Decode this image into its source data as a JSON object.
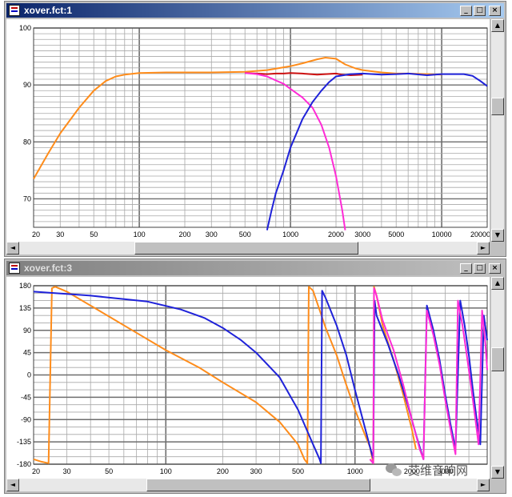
{
  "windows": [
    {
      "id": "top",
      "title": "xover.fct:1",
      "active": true,
      "buttons": {
        "minimize": "_",
        "maximize": "□",
        "close": "×"
      },
      "chart_data": {
        "type": "line",
        "x_scale": "log",
        "xlim": [
          20,
          20000
        ],
        "ylim": [
          65,
          100
        ],
        "x_ticks": [
          20,
          30,
          50,
          100,
          200,
          300,
          500,
          1000,
          2000,
          3000,
          5000,
          10000,
          20000
        ],
        "x_tick_labels": [
          "20",
          "30",
          "50",
          "100",
          "200",
          "300",
          "500",
          "1000",
          "2000",
          "3000",
          "5000",
          "10000",
          "20000"
        ],
        "y_ticks": [
          100,
          90,
          80,
          70
        ],
        "y_tick_labels": [
          "100",
          "90",
          "80",
          "70"
        ],
        "grid": true,
        "series": [
          {
            "color": "#ff8c1a",
            "points": [
              [
                20,
                73.5
              ],
              [
                25,
                78
              ],
              [
                30,
                81.5
              ],
              [
                40,
                86
              ],
              [
                50,
                89
              ],
              [
                60,
                90.7
              ],
              [
                70,
                91.5
              ],
              [
                80,
                91.8
              ],
              [
                100,
                92.1
              ],
              [
                150,
                92.2
              ],
              [
                200,
                92.2
              ],
              [
                300,
                92.2
              ],
              [
                500,
                92.3
              ],
              [
                700,
                92.6
              ],
              [
                900,
                93.1
              ],
              [
                1000,
                93.3
              ],
              [
                1200,
                93.8
              ],
              [
                1500,
                94.5
              ],
              [
                1700,
                94.8
              ],
              [
                2000,
                94.6
              ],
              [
                2300,
                93.6
              ],
              [
                2700,
                92.9
              ],
              [
                3000,
                92.6
              ],
              [
                4000,
                92.2
              ],
              [
                5000,
                92.0
              ],
              [
                6000,
                92.0
              ],
              [
                8000,
                91.9
              ],
              [
                10000,
                91.8
              ]
            ]
          },
          {
            "color": "#cc1010",
            "points": [
              [
                500,
                92.1
              ],
              [
                600,
                92.0
              ],
              [
                700,
                91.9
              ],
              [
                800,
                92.0
              ],
              [
                900,
                92.0
              ],
              [
                1000,
                92.1
              ],
              [
                1200,
                92.0
              ],
              [
                1500,
                91.8
              ],
              [
                1700,
                91.9
              ],
              [
                2000,
                92.0
              ],
              [
                2200,
                91.8
              ],
              [
                2500,
                91.7
              ],
              [
                3000,
                91.8
              ]
            ]
          },
          {
            "color": "#ff2bd6",
            "points": [
              [
                500,
                92.1
              ],
              [
                600,
                91.9
              ],
              [
                700,
                91.5
              ],
              [
                800,
                90.8
              ],
              [
                900,
                90.2
              ],
              [
                1000,
                89.3
              ],
              [
                1200,
                87.8
              ],
              [
                1400,
                86.0
              ],
              [
                1600,
                83.0
              ],
              [
                1800,
                79.0
              ],
              [
                2000,
                74.0
              ],
              [
                2200,
                68.0
              ],
              [
                2300,
                64.5
              ]
            ]
          },
          {
            "color": "#1f22d9",
            "points": [
              [
                700,
                64.5
              ],
              [
                750,
                68.0
              ],
              [
                800,
                71.0
              ],
              [
                900,
                75.0
              ],
              [
                1000,
                79.0
              ],
              [
                1200,
                84.0
              ],
              [
                1400,
                87.0
              ],
              [
                1600,
                89.0
              ],
              [
                1800,
                90.5
              ],
              [
                2000,
                91.5
              ],
              [
                2500,
                91.9
              ],
              [
                3000,
                92.0
              ],
              [
                4000,
                91.8
              ],
              [
                5000,
                91.9
              ],
              [
                6000,
                92.0
              ],
              [
                8000,
                91.7
              ],
              [
                10000,
                91.9
              ],
              [
                14000,
                91.9
              ],
              [
                16000,
                91.6
              ],
              [
                18000,
                90.7
              ],
              [
                20000,
                89.8
              ]
            ]
          }
        ]
      }
    },
    {
      "id": "bottom",
      "title": "xover.fct:3",
      "active": false,
      "buttons": {
        "minimize": "_",
        "maximize": "□",
        "close": "×"
      },
      "chart_data": {
        "type": "line",
        "x_scale": "log",
        "xlim": [
          20,
          5000
        ],
        "ylim": [
          -180,
          180
        ],
        "x_ticks": [
          20,
          30,
          50,
          100,
          200,
          300,
          500,
          1000,
          2000,
          3000
        ],
        "x_tick_labels": [
          "20",
          "30",
          "50",
          "100",
          "200",
          "300",
          "500",
          "1000",
          "2000",
          "3000"
        ],
        "y_ticks": [
          180,
          135,
          90,
          45,
          0,
          -45,
          -90,
          -135,
          -180
        ],
        "y_tick_labels": [
          "180",
          "135",
          "90",
          "45",
          "0",
          "-45",
          "-90",
          "-135",
          "-180"
        ],
        "grid": true,
        "series": [
          {
            "color": "#ff8c1a",
            "points": [
              [
                20,
                -170
              ],
              [
                22,
                -175
              ],
              [
                24,
                -178
              ],
              [
                25,
                175
              ],
              [
                26,
                178
              ],
              [
                30,
                168
              ],
              [
                40,
                140
              ],
              [
                50,
                118
              ],
              [
                70,
                85
              ],
              [
                100,
                50
              ],
              [
                150,
                15
              ],
              [
                200,
                -15
              ],
              [
                300,
                -55
              ],
              [
                400,
                -95
              ],
              [
                500,
                -140
              ],
              [
                540,
                -170
              ],
              [
                560,
                -178
              ],
              [
                570,
                178
              ],
              [
                600,
                170
              ],
              [
                700,
                95
              ],
              [
                800,
                40
              ],
              [
                900,
                -20
              ],
              [
                1000,
                -70
              ],
              [
                1100,
                -110
              ],
              [
                1200,
                -145
              ],
              [
                1250,
                -178
              ],
              [
                1260,
                178
              ],
              [
                1300,
                160
              ],
              [
                1400,
                100
              ],
              [
                1600,
                30
              ],
              [
                1800,
                -40
              ],
              [
                2000,
                -110
              ],
              [
                2100,
                -150
              ]
            ]
          },
          {
            "color": "#1f22d9",
            "points": [
              [
                20,
                168
              ],
              [
                40,
                160
              ],
              [
                80,
                148
              ],
              [
                120,
                132
              ],
              [
                160,
                115
              ],
              [
                200,
                95
              ],
              [
                250,
                70
              ],
              [
                300,
                45
              ],
              [
                400,
                -5
              ],
              [
                500,
                -70
              ],
              [
                600,
                -140
              ],
              [
                650,
                -170
              ],
              [
                660,
                -178
              ],
              [
                670,
                170
              ],
              [
                700,
                155
              ],
              [
                800,
                100
              ],
              [
                900,
                40
              ],
              [
                1000,
                -30
              ],
              [
                1100,
                -90
              ],
              [
                1200,
                -145
              ],
              [
                1250,
                -170
              ],
              [
                1270,
                150
              ],
              [
                1300,
                120
              ],
              [
                1500,
                60
              ],
              [
                1700,
                0
              ],
              [
                1900,
                -60
              ],
              [
                2100,
                -120
              ],
              [
                2300,
                -170
              ],
              [
                2400,
                140
              ],
              [
                2600,
                90
              ],
              [
                2800,
                30
              ],
              [
                3000,
                -40
              ],
              [
                3200,
                -100
              ],
              [
                3400,
                -150
              ],
              [
                3600,
                150
              ],
              [
                3800,
                100
              ],
              [
                4000,
                40
              ],
              [
                4200,
                -30
              ],
              [
                4400,
                -90
              ],
              [
                4600,
                -140
              ],
              [
                4800,
                120
              ],
              [
                5000,
                70
              ]
            ]
          },
          {
            "color": "#ff2bd6",
            "points": [
              [
                1200,
                -170
              ],
              [
                1250,
                -178
              ],
              [
                1260,
                175
              ],
              [
                1300,
                160
              ],
              [
                1400,
                110
              ],
              [
                1600,
                50
              ],
              [
                1800,
                -20
              ],
              [
                2000,
                -90
              ],
              [
                2200,
                -150
              ],
              [
                2300,
                -170
              ],
              [
                2400,
                130
              ],
              [
                2600,
                80
              ],
              [
                2800,
                20
              ],
              [
                3000,
                -50
              ],
              [
                3200,
                -110
              ],
              [
                3400,
                -160
              ],
              [
                3500,
                150
              ],
              [
                3700,
                100
              ],
              [
                3900,
                40
              ],
              [
                4100,
                -20
              ],
              [
                4300,
                -80
              ],
              [
                4500,
                -140
              ],
              [
                4700,
                130
              ],
              [
                4900,
                60
              ],
              [
                5000,
                10
              ]
            ]
          }
        ]
      }
    }
  ],
  "watermark": {
    "text": "艾维音响网"
  }
}
